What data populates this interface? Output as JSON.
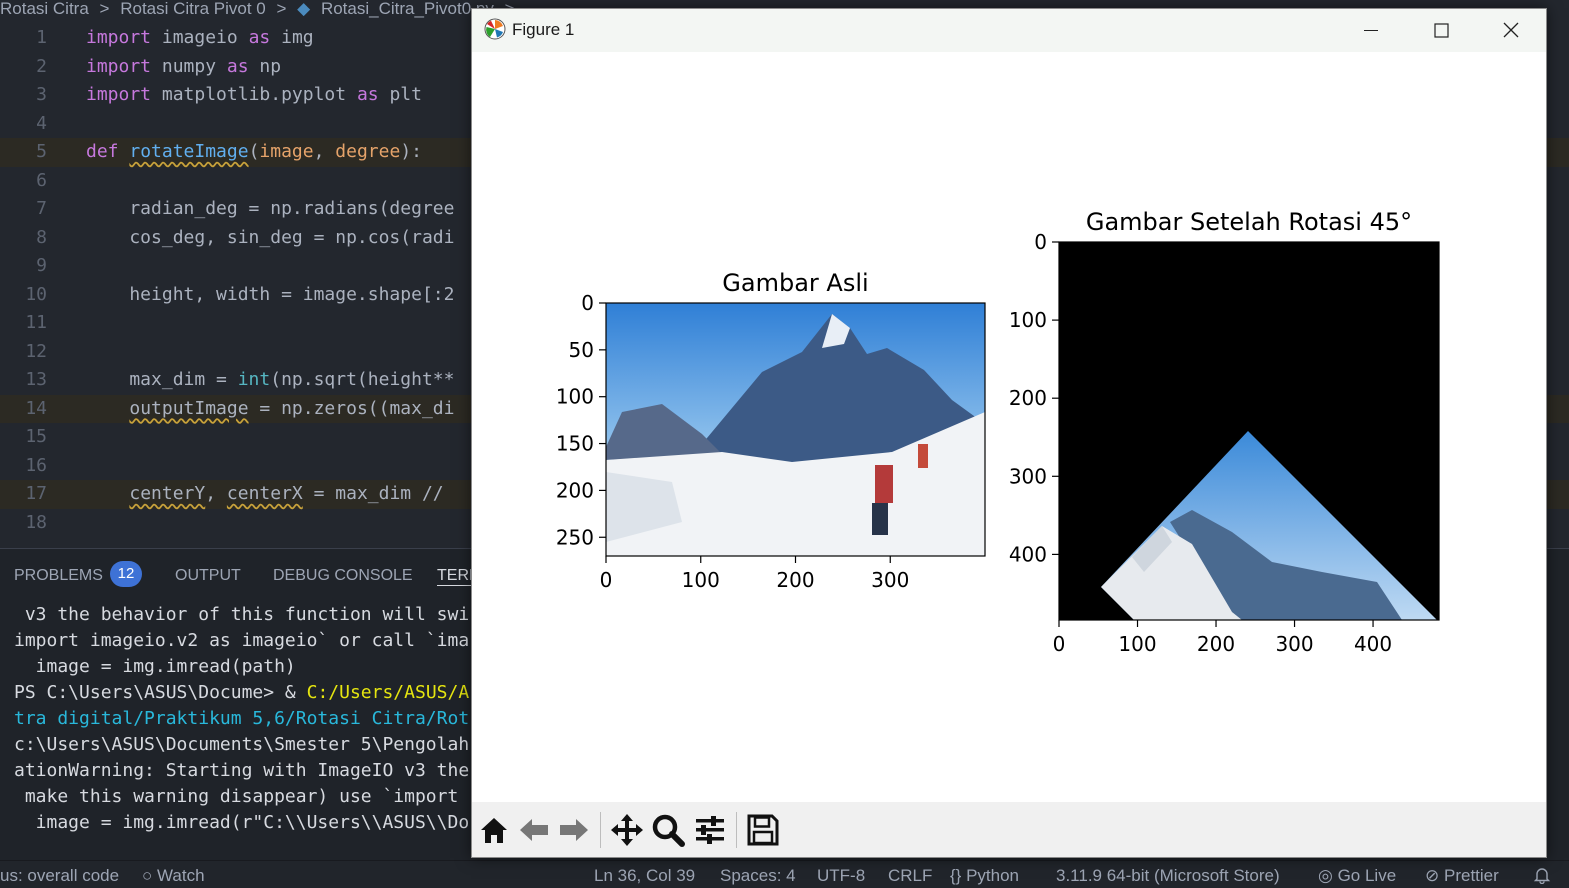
{
  "editor": {
    "breadcrumb": [
      "Rotasi Citra",
      ">",
      "Rotasi Citra Pivot 0",
      ">",
      "Rotasi_Citra_Pivot0.py",
      ">"
    ],
    "lines": [
      {
        "n": "1",
        "code": "import imageio as img"
      },
      {
        "n": "2",
        "code": "import numpy as np"
      },
      {
        "n": "3",
        "code": "import matplotlib.pyplot as plt"
      },
      {
        "n": "4",
        "code": ""
      },
      {
        "n": "5",
        "code": "def rotateImage(image, degree):"
      },
      {
        "n": "6",
        "code": ""
      },
      {
        "n": "7",
        "code": "    radian_deg = np.radians(degree"
      },
      {
        "n": "8",
        "code": "    cos_deg, sin_deg = np.cos(radi"
      },
      {
        "n": "9",
        "code": ""
      },
      {
        "n": "10",
        "code": "    height, width = image.shape[:2"
      },
      {
        "n": "11",
        "code": ""
      },
      {
        "n": "12",
        "code": ""
      },
      {
        "n": "13",
        "code": "    max_dim = int(np.sqrt(height**"
      },
      {
        "n": "14",
        "code": "    outputImage = np.zeros((max_di"
      },
      {
        "n": "15",
        "code": ""
      },
      {
        "n": "16",
        "code": ""
      },
      {
        "n": "17",
        "code": "    centerY, centerX = max_dim // "
      },
      {
        "n": "18",
        "code": ""
      }
    ]
  },
  "panel": {
    "tabs": [
      "PROBLEMS",
      "OUTPUT",
      "DEBUG CONSOLE",
      "TERM"
    ],
    "problems_count": "12",
    "terminal": [
      " v3 the behavior of this function will swi",
      "import imageio.v2 as imageio` or call `ima",
      "  image = img.imread(path)",
      "PS C:\\Users\\ASUS\\Docume> & ",
      "C:/Users/ASUS/A",
      "tra digital/Praktikum 5,6/Rotasi Citra/Rot",
      "c:\\Users\\ASUS\\Documents\\Smester 5\\Pengolah",
      "ationWarning: Starting with ImageIO v3 the",
      " make this warning disappear) use `import ",
      "  image = img.imread(r\"C:\\\\Users\\\\ASUS\\\\Do"
    ]
  },
  "statusbar": {
    "left_text": "us: overall code",
    "watch": "Watch",
    "position": "Ln 36, Col 39",
    "spaces": "Spaces: 4",
    "encoding": "UTF-8",
    "eol": "CRLF",
    "language": "{} Python",
    "interpreter": "3.11.9 64-bit (Microsoft Store)",
    "golive": "Go Live",
    "prettier": "Prettier"
  },
  "figure": {
    "window_title": "Figure 1",
    "toolbar_icons": [
      "home-icon",
      "back-arrow-icon",
      "forward-arrow-icon",
      "pan-icon",
      "zoom-icon",
      "configure-subplots-icon",
      "save-icon"
    ]
  },
  "chart_data": [
    {
      "type": "image",
      "title": "Gambar Asli",
      "xticks": [
        "0",
        "100",
        "200",
        "300"
      ],
      "yticks": [
        "0",
        "50",
        "100",
        "150",
        "200",
        "250"
      ],
      "xlim": [
        0,
        400
      ],
      "ylim": [
        270,
        0
      ]
    },
    {
      "type": "image",
      "title": "Gambar Setelah Rotasi 45°",
      "xticks": [
        "0",
        "100",
        "200",
        "300",
        "400"
      ],
      "yticks": [
        "0",
        "100",
        "200",
        "300",
        "400"
      ],
      "xlim": [
        0,
        484
      ],
      "ylim": [
        484,
        0
      ]
    }
  ]
}
